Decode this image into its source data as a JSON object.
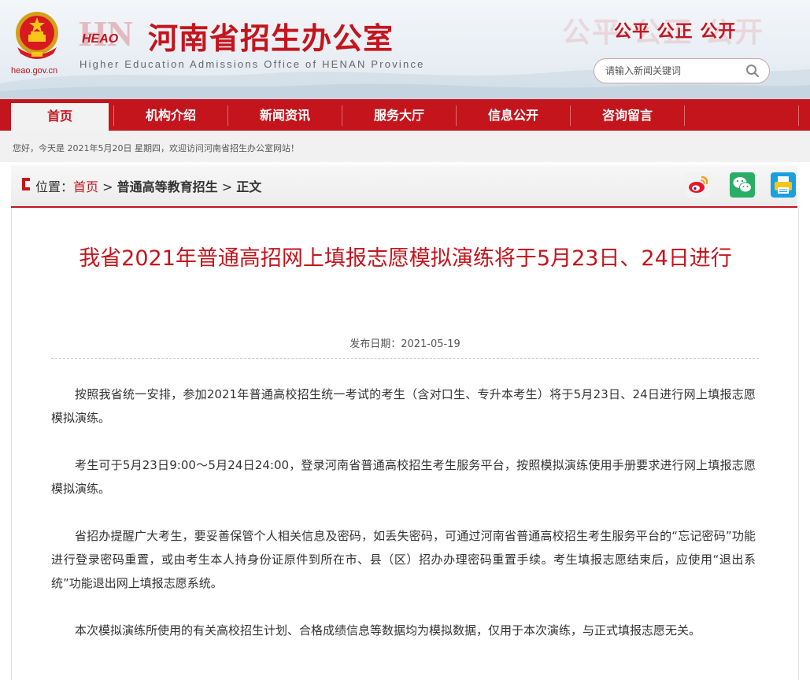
{
  "header": {
    "domain": "heao.gov.cn",
    "logo_mark": "HEAO",
    "title": "河南省招生办公室",
    "subtitle": "Higher Education Admissions Office of HENAN Province",
    "slogan_bg": "公平 公正 公开",
    "slogan": "公平 公正 公开",
    "search_placeholder": "请输入新闻关键词",
    "icons": [
      "national-emblem-icon",
      "search-icon"
    ]
  },
  "nav": {
    "items": [
      {
        "label": "首页",
        "active": true
      },
      {
        "label": "机构介绍",
        "active": false
      },
      {
        "label": "新闻资讯",
        "active": false
      },
      {
        "label": "服务大厅",
        "active": false
      },
      {
        "label": "信息公开",
        "active": false
      },
      {
        "label": "咨询留言",
        "active": false
      }
    ]
  },
  "greeting": "您好，今天是 2021年5月20日 星期四，欢迎访问河南省招生办公室网站！",
  "breadcrumb": {
    "prefix": "位置：",
    "home": "首页",
    "sep1": " > ",
    "section": "普通高等教育招生",
    "sep2": " > ",
    "current": "正文"
  },
  "share": {
    "icons": [
      "weibo-icon",
      "wechat-icon",
      "print-icon"
    ],
    "colors": {
      "weibo": "#e6162d",
      "wechat": "#2aae67",
      "print": "#1a9fe0"
    }
  },
  "article": {
    "title": "我省2021年普通高招网上填报志愿模拟演练将于5月23日、24日进行",
    "date_label": "发布日期：",
    "date": "2021-05-19",
    "paragraphs": [
      "按照我省统一安排，参加2021年普通高校招生统一考试的考生（含对口生、专升本考生）将于5月23日、24日进行网上填报志愿模拟演练。",
      "考生可于5月23日9:00～5月24日24:00，登录河南省普通高校招生考生服务平台，按照模拟演练使用手册要求进行网上填报志愿模拟演练。",
      "省招办提醒广大考生，要妥善保管个人相关信息及密码，如丢失密码，可通过河南省普通高校招生考生服务平台的“忘记密码”功能进行登录密码重置，或由考生本人持身份证原件到所在市、县（区）招办办理密码重置手续。考生填报志愿结束后，应使用“退出系统”功能退出网上填报志愿系统。",
      "本次模拟演练所使用的有关高校招生计划、合格成绩信息等数据均为模拟数据，仅用于本次演练，与正式填报志愿无关。"
    ]
  },
  "colors": {
    "brand_red": "#c4151d",
    "nav_bg": "#c4151d",
    "greeting_bg": "#f1f1f1"
  }
}
